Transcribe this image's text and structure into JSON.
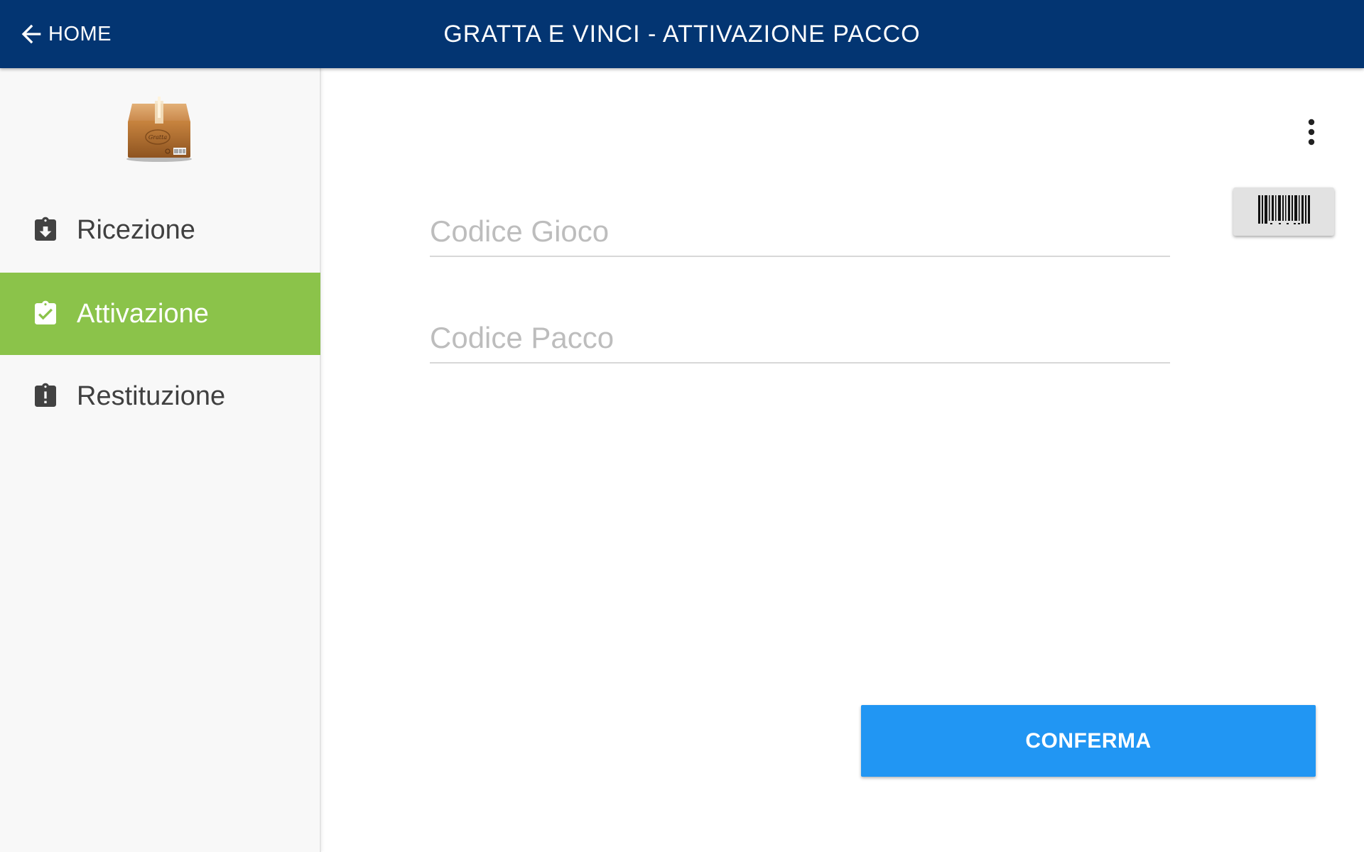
{
  "appbar": {
    "back_label": "HOME",
    "title": "GRATTA E VINCI - ATTIVAZIONE PACCO",
    "background_color": "#033572"
  },
  "sidebar": {
    "logo_icon": "package-box-icon",
    "logo_text": "Gratta",
    "items": [
      {
        "label": "Ricezione",
        "icon": "clipboard-arrow-down-icon",
        "active": false
      },
      {
        "label": "Attivazione",
        "icon": "clipboard-check-icon",
        "active": true
      },
      {
        "label": "Restituzione",
        "icon": "clipboard-alert-icon",
        "active": false
      }
    ],
    "active_color": "#8bc34a"
  },
  "form": {
    "codice_gioco": {
      "value": "",
      "placeholder": "Codice Gioco"
    },
    "codice_pacco": {
      "value": "",
      "placeholder": "Codice Pacco"
    }
  },
  "actions": {
    "overflow_icon": "more-vert-icon",
    "scan_icon": "barcode-icon",
    "confirm_label": "CONFERMA",
    "confirm_color": "#2196f3"
  }
}
